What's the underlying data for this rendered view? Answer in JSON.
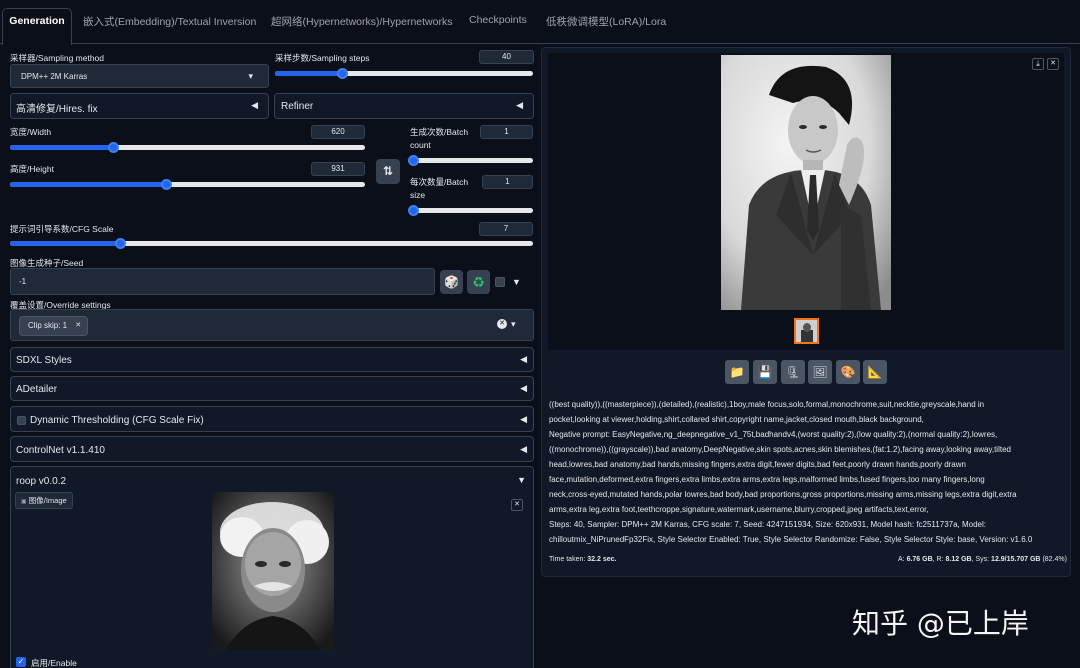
{
  "tabs": [
    "Generation",
    "嵌入式(Embedding)/Textual Inversion",
    "超网络(Hypernetworks)/Hypernetworks",
    "Checkpoints",
    "低秩微调模型(LoRA)/Lora"
  ],
  "sampler": {
    "label": "采样器/Sampling method",
    "value": "DPM++ 2M Karras"
  },
  "steps": {
    "label": "采样步数/Sampling steps",
    "value": "40",
    "fraction": 0.26
  },
  "hires": {
    "label": "高清修复/Hires. fix"
  },
  "refiner": {
    "label": "Refiner"
  },
  "width": {
    "label": "宽度/Width",
    "value": "620",
    "fraction": 0.29
  },
  "height": {
    "label": "高度/Height",
    "value": "931",
    "fraction": 0.44
  },
  "swap_icon": "⇅",
  "batch_count": {
    "label_line1": "生成次数/Batch",
    "label_line2": "count",
    "value": "1",
    "fraction": 0.0
  },
  "batch_size": {
    "label_line1": "每次数量/Batch",
    "label_line2": "size",
    "value": "1",
    "fraction": 0.0
  },
  "cfg": {
    "label": "提示词引导系数/CFG Scale",
    "value": "7",
    "fraction": 0.21
  },
  "seed": {
    "label": "图像生成种子/Seed",
    "value": "-1"
  },
  "override": {
    "label": "覆盖设置/Override settings",
    "chip": "Clip skip: 1"
  },
  "accordions": {
    "sdxl": "SDXL Styles",
    "adetailer": "ADetailer",
    "dynamic": "Dynamic Thresholding (CFG Scale Fix)",
    "controlnet": "ControlNet v1.1.410",
    "roop": "roop v0.0.2"
  },
  "roop": {
    "image_label": "图像/Image",
    "enable_label": "启用/Enable",
    "enabled": true
  },
  "output": {
    "info_lines": [
      "((best quality)),((masterpiece)),(detailed),(realistic),1boy,male focus,solo,formal,monochrome,suit,necktie,greyscale,hand in",
      "pocket,looking at viewer,holding,shirt,collared shirt,copyright name,jacket,closed mouth,black background,",
      "Negative prompt: EasyNegative,ng_deepnegative_v1_75t,badhandv4,(worst quality:2),(low quality:2),(normal quality:2),lowres,",
      "((monochrome)),((grayscale)),bad anatomy,DeepNegative,skin spots,acnes,skin blemishes,(fat:1.2),facing away,looking away,tilted",
      "head,lowres,bad anatomy,bad hands,missing fingers,extra digit,fewer digits,bad feet,poorly drawn hands,poorly drawn",
      "face,mutation,deformed,extra fingers,extra limbs,extra arms,extra legs,malformed limbs,fused fingers,too many fingers,long",
      "neck,cross-eyed,mutated hands,polar lowres,bad body,bad proportions,gross proportions,missing arms,missing legs,extra digit,extra",
      "arms,extra leg,extra foot,teethcroppe,signature,watermark,username,blurry,cropped,jpeg artifacts,text,error,",
      "Steps: 40, Sampler: DPM++ 2M Karras, CFG scale: 7, Seed: 4247151934, Size: 620x931, Model hash: fc2511737a, Model:",
      "chilloutmix_NiPrunedFp32Fix, Style Selector Enabled: True, Style Selector Randomize: False, Style Selector Style: base, Version: v1.6.0"
    ],
    "time_label": "Time taken:",
    "time_value": "32.2 sec.",
    "mem_a_label": "A:",
    "mem_a": "6.76 GB",
    "mem_r_label": "R:",
    "mem_r": "8.12 GB",
    "mem_sys_label": "Sys:",
    "mem_sys": "12.9/15.707 GB",
    "mem_pct": "(82.4%)"
  },
  "watermark": "知乎 @已上岸",
  "icons": {
    "folder": "📁",
    "save": "💾",
    "zip": "🗜",
    "image": "🖼",
    "palette": "🎨",
    "ruler": "📐",
    "dice": "🎲",
    "recycle": "♻",
    "download": "⤓",
    "close": "✕",
    "triangle_left": "◀",
    "triangle_down": "▼",
    "dropdown": "▾"
  },
  "colors": {
    "accent": "#2563eb",
    "background": "#0b0f19",
    "panel": "#111827",
    "border": "#374151"
  }
}
